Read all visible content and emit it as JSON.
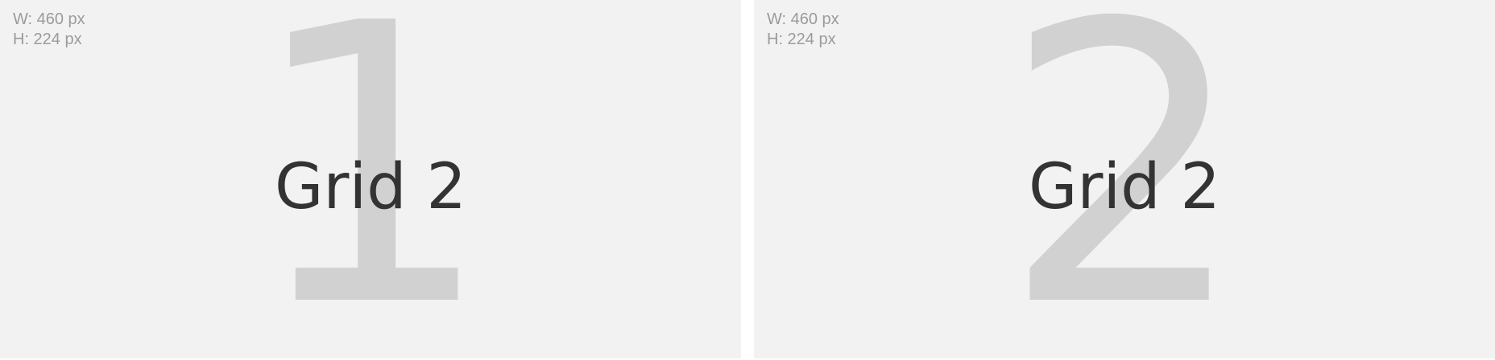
{
  "cells": [
    {
      "number": "1",
      "label": "Grid 2",
      "width_text": "W: 460 px",
      "height_text": "H: 224 px"
    },
    {
      "number": "2",
      "label": "Grid 2",
      "width_text": "W: 460 px",
      "height_text": "H: 224 px"
    }
  ],
  "colors": {
    "cell_background": "#f2f2f2",
    "big_number": "#d1d1d1",
    "label_text": "#333333",
    "dims_text": "#9b9b9b"
  }
}
